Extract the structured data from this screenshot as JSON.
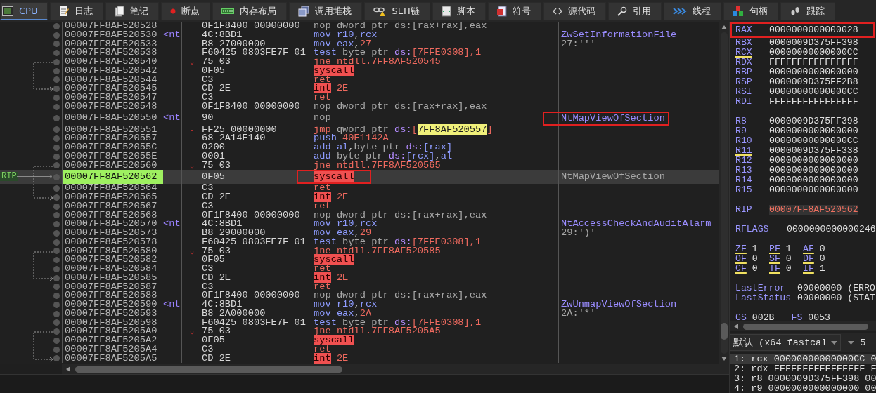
{
  "tabs": [
    {
      "label": "CPU",
      "selected": true
    },
    {
      "label": "日志",
      "selected": false
    },
    {
      "label": "笔记",
      "selected": false
    },
    {
      "label": "断点",
      "selected": false
    },
    {
      "label": "内存布局",
      "selected": false
    },
    {
      "label": "调用堆栈",
      "selected": false
    },
    {
      "label": "SEH链",
      "selected": false
    },
    {
      "label": "脚本",
      "selected": false
    },
    {
      "label": "符号",
      "selected": false
    },
    {
      "label": "源代码",
      "selected": false
    },
    {
      "label": "引用",
      "selected": false
    },
    {
      "label": "线程",
      "selected": false
    },
    {
      "label": "句柄",
      "selected": false
    },
    {
      "label": "跟踪",
      "selected": false
    }
  ],
  "disassembly": {
    "rows": [
      {
        "address": "00007FF8AF520528",
        "bytes": "0F1F8400 00000000",
        "selected": false,
        "instruction": {
          "mnemonic": "nop",
          "kind": "nop",
          "operands": [
            {
              "text": "dword ptr ds:[rax+rax],eax",
              "kind": "plain"
            }
          ]
        }
      },
      {
        "address": "00007FF8AF520530",
        "label": "<nt",
        "bytes": "4C:8BD1",
        "selected": false,
        "instruction": {
          "mnemonic": "mov",
          "kind": "mov",
          "operands": [
            {
              "text": "r10",
              "kind": "reg"
            },
            {
              "text": ",",
              "kind": "plain"
            },
            {
              "text": "rcx",
              "kind": "reg"
            }
          ]
        },
        "comment": {
          "text": "ZwSetInformationFile",
          "kind": "symbol"
        }
      },
      {
        "address": "00007FF8AF520533",
        "bytes": "B8 27000000",
        "selected": false,
        "instruction": {
          "mnemonic": "mov",
          "kind": "mov",
          "operands": [
            {
              "text": "eax",
              "kind": "reg"
            },
            {
              "text": ",",
              "kind": "plain"
            },
            {
              "text": "27",
              "kind": "num"
            }
          ]
        },
        "comment": {
          "text": "27:'''",
          "kind": "value"
        }
      },
      {
        "address": "00007FF8AF520538",
        "bytes": "F60425 0803FE7F 01",
        "selected": false,
        "instruction": {
          "mnemonic": "test",
          "kind": "test",
          "operands": [
            {
              "text": "byte ptr",
              "kind": "ptr"
            },
            {
              "text": " ds:",
              "kind": "seg"
            },
            {
              "text": "[7FFE0308],1",
              "kind": "num"
            }
          ]
        }
      },
      {
        "address": "00007FF8AF520540",
        "bytes": "75 03",
        "branch_mark": "⌄",
        "jump_start": true,
        "selected": false,
        "instruction": {
          "mnemonic": "jne",
          "kind": "jump",
          "operands": [
            {
              "text": "ntdll.7FF8AF520545",
              "kind": "num"
            }
          ]
        }
      },
      {
        "address": "00007FF8AF520542",
        "bytes": "0F05",
        "selected": false,
        "instruction": {
          "mnemonic": "syscall",
          "kind": "system"
        }
      },
      {
        "address": "00007FF8AF520544",
        "bytes": "C3",
        "selected": false,
        "instruction": {
          "mnemonic": "ret",
          "kind": "ret"
        }
      },
      {
        "address": "00007FF8AF520545",
        "bytes": "CD 2E",
        "jump_end": true,
        "selected": false,
        "instruction": {
          "mnemonic": "int",
          "kind": "system",
          "operands": [
            {
              "text": "2E",
              "kind": "num"
            }
          ]
        }
      },
      {
        "address": "00007FF8AF520547",
        "bytes": "C3",
        "selected": false,
        "instruction": {
          "mnemonic": "ret",
          "kind": "ret"
        }
      },
      {
        "address": "00007FF8AF520548",
        "bytes": "0F1F8400 00000000",
        "selected": false,
        "instruction": {
          "mnemonic": "nop",
          "kind": "nop",
          "operands": [
            {
              "text": "dword ptr ds:[rax+rax],eax",
              "kind": "plain"
            }
          ]
        }
      },
      {
        "address": "00007FF8AF520550",
        "label": "<nt",
        "bytes": "90",
        "selected": false,
        "instruction": {
          "mnemonic": "nop",
          "kind": "nop"
        },
        "comment": {
          "text": "NtMapViewOfSection",
          "kind": "symbol",
          "outlined": true
        }
      },
      {
        "address": "00007FF8AF520551",
        "bytes": "FF25 00000000",
        "branch_mark": "-",
        "selected": false,
        "instruction": {
          "mnemonic": "jmp",
          "kind": "jump",
          "operands": [
            {
              "text": "qword ptr",
              "kind": "ptr"
            },
            {
              "text": " ds:",
              "kind": "seg"
            },
            {
              "text": "[",
              "kind": "plain"
            },
            {
              "text": "7FF8AF520557",
              "kind": "highlight"
            },
            {
              "text": "]",
              "kind": "plain"
            }
          ]
        }
      },
      {
        "address": "00007FF8AF520557",
        "bytes": "68 2A14E140",
        "selected": false,
        "instruction": {
          "mnemonic": "push",
          "kind": "mov",
          "operands": [
            {
              "text": "40E1142A",
              "kind": "num"
            }
          ]
        }
      },
      {
        "address": "00007FF8AF52055C",
        "bytes": "0200",
        "selected": false,
        "instruction": {
          "mnemonic": "add",
          "kind": "mov",
          "operands": [
            {
              "text": "al",
              "kind": "reg"
            },
            {
              "text": ",",
              "kind": "plain"
            },
            {
              "text": "byte ptr",
              "kind": "ptr"
            },
            {
              "text": " ds:",
              "kind": "seg"
            },
            {
              "text": "[rax]",
              "kind": "reg"
            }
          ]
        }
      },
      {
        "address": "00007FF8AF52055E",
        "bytes": "0001",
        "selected": false,
        "instruction": {
          "mnemonic": "add",
          "kind": "mov",
          "operands": [
            {
              "text": "byte ptr",
              "kind": "ptr"
            },
            {
              "text": " ds:",
              "kind": "seg"
            },
            {
              "text": "[rcx]",
              "kind": "reg"
            },
            {
              "text": ",",
              "kind": "plain"
            },
            {
              "text": "al",
              "kind": "reg"
            }
          ]
        }
      },
      {
        "address": "00007FF8AF520560",
        "bytes": "75 03",
        "branch_mark": "⌄",
        "jump_start": true,
        "selected": false,
        "instruction": {
          "mnemonic": "jne",
          "kind": "jump",
          "operands": [
            {
              "text": "ntdll.7FF8AF520565",
              "kind": "num"
            }
          ]
        }
      },
      {
        "address": "00007FF8AF520562",
        "bytes": "0F05",
        "marker": "RIP",
        "selected": true,
        "instruction": {
          "mnemonic": "syscall",
          "kind": "system",
          "outlined": true
        },
        "comment": {
          "text": "NtMapViewOfSection",
          "kind": "value"
        }
      },
      {
        "address": "00007FF8AF520564",
        "bytes": "C3",
        "selected": false,
        "instruction": {
          "mnemonic": "ret",
          "kind": "ret"
        }
      },
      {
        "address": "00007FF8AF520565",
        "bytes": "CD 2E",
        "jump_end": true,
        "selected": false,
        "instruction": {
          "mnemonic": "int",
          "kind": "system",
          "operands": [
            {
              "text": "2E",
              "kind": "num"
            }
          ]
        }
      },
      {
        "address": "00007FF8AF520567",
        "bytes": "C3",
        "selected": false,
        "instruction": {
          "mnemonic": "ret",
          "kind": "ret"
        }
      },
      {
        "address": "00007FF8AF520568",
        "bytes": "0F1F8400 00000000",
        "selected": false,
        "instruction": {
          "mnemonic": "nop",
          "kind": "nop",
          "operands": [
            {
              "text": "dword ptr ds:[rax+rax],eax",
              "kind": "plain"
            }
          ]
        }
      },
      {
        "address": "00007FF8AF520570",
        "label": "<nt",
        "bytes": "4C:8BD1",
        "selected": false,
        "instruction": {
          "mnemonic": "mov",
          "kind": "mov",
          "operands": [
            {
              "text": "r10",
              "kind": "reg"
            },
            {
              "text": ",",
              "kind": "plain"
            },
            {
              "text": "rcx",
              "kind": "reg"
            }
          ]
        },
        "comment": {
          "text": "NtAccessCheckAndAuditAlarm",
          "kind": "symbol"
        }
      },
      {
        "address": "00007FF8AF520573",
        "bytes": "B8 29000000",
        "selected": false,
        "instruction": {
          "mnemonic": "mov",
          "kind": "mov",
          "operands": [
            {
              "text": "eax",
              "kind": "reg"
            },
            {
              "text": ",",
              "kind": "plain"
            },
            {
              "text": "29",
              "kind": "num"
            }
          ]
        },
        "comment": {
          "text": "29:')'",
          "kind": "value"
        }
      },
      {
        "address": "00007FF8AF520578",
        "bytes": "F60425 0803FE7F 01",
        "selected": false,
        "instruction": {
          "mnemonic": "test",
          "kind": "test",
          "operands": [
            {
              "text": "byte ptr",
              "kind": "ptr"
            },
            {
              "text": " ds:",
              "kind": "seg"
            },
            {
              "text": "[7FFE0308],1",
              "kind": "num"
            }
          ]
        }
      },
      {
        "address": "00007FF8AF520580",
        "bytes": "75 03",
        "branch_mark": "⌄",
        "jump_start": true,
        "selected": false,
        "instruction": {
          "mnemonic": "jne",
          "kind": "jump",
          "operands": [
            {
              "text": "ntdll.7FF8AF520585",
              "kind": "num"
            }
          ]
        }
      },
      {
        "address": "00007FF8AF520582",
        "bytes": "0F05",
        "selected": false,
        "instruction": {
          "mnemonic": "syscall",
          "kind": "system"
        }
      },
      {
        "address": "00007FF8AF520584",
        "bytes": "C3",
        "selected": false,
        "instruction": {
          "mnemonic": "ret",
          "kind": "ret"
        }
      },
      {
        "address": "00007FF8AF520585",
        "bytes": "CD 2E",
        "jump_end": true,
        "selected": false,
        "instruction": {
          "mnemonic": "int",
          "kind": "system",
          "operands": [
            {
              "text": "2E",
              "kind": "num"
            }
          ]
        }
      },
      {
        "address": "00007FF8AF520587",
        "bytes": "C3",
        "selected": false,
        "instruction": {
          "mnemonic": "ret",
          "kind": "ret"
        }
      },
      {
        "address": "00007FF8AF520588",
        "bytes": "0F1F8400 00000000",
        "selected": false,
        "instruction": {
          "mnemonic": "nop",
          "kind": "nop",
          "operands": [
            {
              "text": "dword ptr ds:[rax+rax],eax",
              "kind": "plain"
            }
          ]
        }
      },
      {
        "address": "00007FF8AF520590",
        "label": "<nt",
        "bytes": "4C:8BD1",
        "selected": false,
        "instruction": {
          "mnemonic": "mov",
          "kind": "mov",
          "operands": [
            {
              "text": "r10",
              "kind": "reg"
            },
            {
              "text": ",",
              "kind": "plain"
            },
            {
              "text": "rcx",
              "kind": "reg"
            }
          ]
        },
        "comment": {
          "text": "ZwUnmapViewOfSection",
          "kind": "symbol"
        }
      },
      {
        "address": "00007FF8AF520593",
        "bytes": "B8 2A000000",
        "selected": false,
        "instruction": {
          "mnemonic": "mov",
          "kind": "mov",
          "operands": [
            {
              "text": "eax",
              "kind": "reg"
            },
            {
              "text": ",",
              "kind": "plain"
            },
            {
              "text": "2A",
              "kind": "num"
            }
          ]
        },
        "comment": {
          "text": "2A:'*'",
          "kind": "value"
        }
      },
      {
        "address": "00007FF8AF520598",
        "bytes": "F60425 0803FE7F 01",
        "selected": false,
        "instruction": {
          "mnemonic": "test",
          "kind": "test",
          "operands": [
            {
              "text": "byte ptr",
              "kind": "ptr"
            },
            {
              "text": " ds:",
              "kind": "seg"
            },
            {
              "text": "[7FFE0308],1",
              "kind": "num"
            }
          ]
        }
      },
      {
        "address": "00007FF8AF5205A0",
        "bytes": "75 03",
        "branch_mark": "⌄",
        "jump_start": true,
        "selected": false,
        "instruction": {
          "mnemonic": "jne",
          "kind": "jump",
          "operands": [
            {
              "text": "ntdll.7FF8AF5205A5",
              "kind": "num"
            }
          ]
        }
      },
      {
        "address": "00007FF8AF5205A2",
        "bytes": "0F05",
        "selected": false,
        "instruction": {
          "mnemonic": "syscall",
          "kind": "system"
        }
      },
      {
        "address": "00007FF8AF5205A4",
        "bytes": "C3",
        "selected": false,
        "instruction": {
          "mnemonic": "ret",
          "kind": "ret"
        }
      },
      {
        "address": "00007FF8AF5205A5",
        "bytes": "CD 2E",
        "jump_end": true,
        "selected": false,
        "instruction": {
          "mnemonic": "int",
          "kind": "system",
          "operands": [
            {
              "text": "2E",
              "kind": "num"
            }
          ]
        }
      }
    ]
  },
  "registers": {
    "groups": [
      {
        "kind": "general",
        "items": [
          {
            "name": "RAX",
            "value": "0000000000000028",
            "modified": false,
            "outlined": true
          },
          {
            "name": "RBX",
            "value": "0000009D375FF398",
            "modified": false
          },
          {
            "name": "RCX",
            "value": "00000000000000CC",
            "modified": true
          },
          {
            "name": "RDX",
            "value": "FFFFFFFFFFFFFFFF",
            "modified": false
          },
          {
            "name": "RBP",
            "value": "0000000000000000",
            "modified": false
          },
          {
            "name": "RSP",
            "value": "0000009D375FF2B8",
            "modified": false
          },
          {
            "name": "RSI",
            "value": "00000000000000CC",
            "modified": false
          },
          {
            "name": "RDI",
            "value": "FFFFFFFFFFFFFFFF",
            "modified": false
          }
        ]
      },
      {
        "kind": "general",
        "items": [
          {
            "name": "R8",
            "value": "0000009D375FF398",
            "modified": false
          },
          {
            "name": "R9",
            "value": "0000000000000000",
            "modified": false
          },
          {
            "name": "R10",
            "value": "00000000000000CC",
            "modified": false
          },
          {
            "name": "R11",
            "value": "0000009D375FF338",
            "modified": true
          },
          {
            "name": "R12",
            "value": "0000000000000000",
            "modified": false
          },
          {
            "name": "R13",
            "value": "0000000000000000",
            "modified": false
          },
          {
            "name": "R14",
            "value": "0000000000000000",
            "modified": false
          },
          {
            "name": "R15",
            "value": "0000000000000000",
            "modified": false
          }
        ]
      },
      {
        "kind": "pointer",
        "items": [
          {
            "name": "RIP",
            "value": "00007FF8AF520562",
            "modified": false
          }
        ]
      },
      {
        "kind": "wide",
        "items": [
          {
            "name": "RFLAGS",
            "value": "0000000000000246",
            "modified": false
          }
        ]
      },
      {
        "kind": "flags",
        "items": [
          {
            "name": "ZF",
            "value": "1",
            "modified": true
          },
          {
            "name": "PF",
            "value": "1",
            "modified": true
          },
          {
            "name": "AF",
            "value": "0",
            "modified": true
          },
          {
            "name": "OF",
            "value": "0",
            "modified": true
          },
          {
            "name": "SF",
            "value": "0",
            "modified": true
          },
          {
            "name": "DF",
            "value": "0",
            "modified": true
          },
          {
            "name": "CF",
            "value": "0",
            "modified": true
          },
          {
            "name": "TF",
            "value": "0",
            "modified": true
          },
          {
            "name": "IF",
            "value": "1",
            "modified": true
          }
        ]
      },
      {
        "kind": "status",
        "items": [
          {
            "name": "LastError",
            "value": "00000000 (ERRO",
            "modified": false
          },
          {
            "name": "LastStatus",
            "value": "00000000 (STAT",
            "modified": false
          }
        ]
      },
      {
        "kind": "segments",
        "items": [
          {
            "name": "GS",
            "value": "002B"
          },
          {
            "name": "FS",
            "value": "0053"
          }
        ]
      }
    ]
  },
  "call_convention": {
    "value": "默认 (x64 fastcal",
    "count": "5"
  },
  "arguments": [
    {
      "text": "1: rcx 00000000000000CC 0",
      "selected": true
    },
    {
      "text": "2: rdx FFFFFFFFFFFFFFFF F",
      "selected": false
    },
    {
      "text": "3: r8 0000009D375FF398 00",
      "selected": false
    },
    {
      "text": "4: r9 0000000000000000 00",
      "selected": false
    }
  ]
}
